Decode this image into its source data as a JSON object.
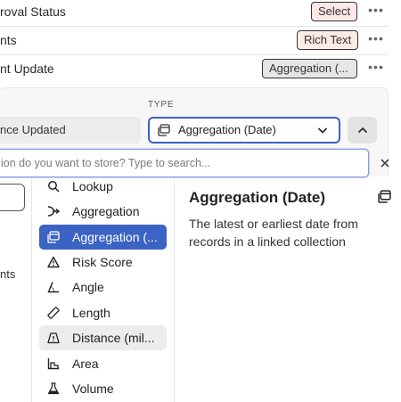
{
  "fields": [
    {
      "name": "roval Status",
      "type": "Select"
    },
    {
      "name": "nts",
      "type": "Rich Text"
    },
    {
      "name": "nt Update",
      "type": "Aggregation (..."
    }
  ],
  "editor": {
    "type_label": "TYPE",
    "name_value": "nce Updated",
    "type_value": "Aggregation (Date)",
    "search_placeholder": "ion do you want to store? Type to search...",
    "left_stub_text": "nts"
  },
  "options": [
    {
      "label": "Lookup",
      "icon": "search-icon",
      "state": "normal"
    },
    {
      "label": "Aggregation",
      "icon": "arrow-merge-icon",
      "state": "normal"
    },
    {
      "label": "Aggregation (...",
      "icon": "calendar-stack-icon",
      "state": "selected"
    },
    {
      "label": "Risk Score",
      "icon": "warning-triangle-icon",
      "state": "normal"
    },
    {
      "label": "Angle",
      "icon": "angle-icon",
      "state": "normal"
    },
    {
      "label": "Length",
      "icon": "ruler-icon",
      "state": "normal"
    },
    {
      "label": "Distance (mil...",
      "icon": "distance-warning-icon",
      "state": "hover"
    },
    {
      "label": "Area",
      "icon": "area-icon",
      "state": "normal"
    },
    {
      "label": "Volume",
      "icon": "flask-icon",
      "state": "normal"
    }
  ],
  "detail": {
    "title": "Aggregation (Date)",
    "description": "The latest or earliest date from records in a linked collection"
  },
  "colors": {
    "accent": "#3b63c4",
    "select_badge": "#fde7e7",
    "rich_text_badge": "#fdece4",
    "aggregation_badge": "#e6e6e6"
  }
}
